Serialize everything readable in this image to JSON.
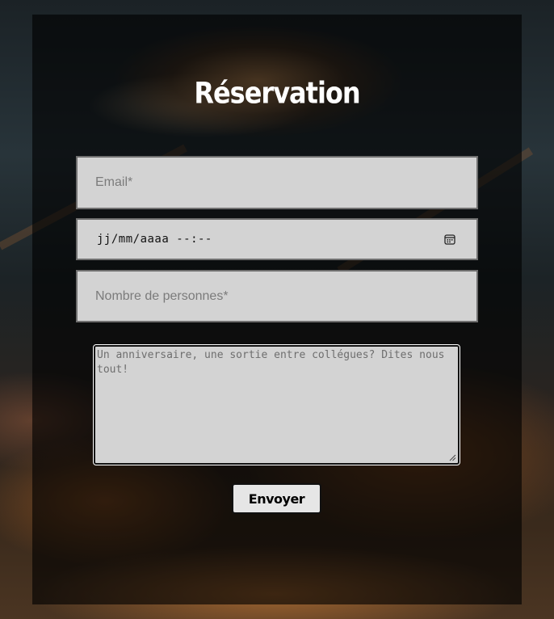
{
  "page": {
    "title": "Réservation"
  },
  "form": {
    "email_placeholder": "Email*",
    "datetime_placeholder": "jj/mm/aaaa  --:--",
    "people_placeholder": "Nombre de personnes*",
    "message_placeholder": "Un anniversaire, une sortie entre collégues? Dites nous tout!",
    "submit_label": "Envoyer"
  },
  "icons": {
    "datetime": "calendar-icon",
    "resize": "resize-grip-icon"
  },
  "colors": {
    "panel_overlay": "#000000",
    "field_background": "#d3d3d3",
    "title_text": "#ffffff",
    "button_background": "#e6e6e6"
  }
}
